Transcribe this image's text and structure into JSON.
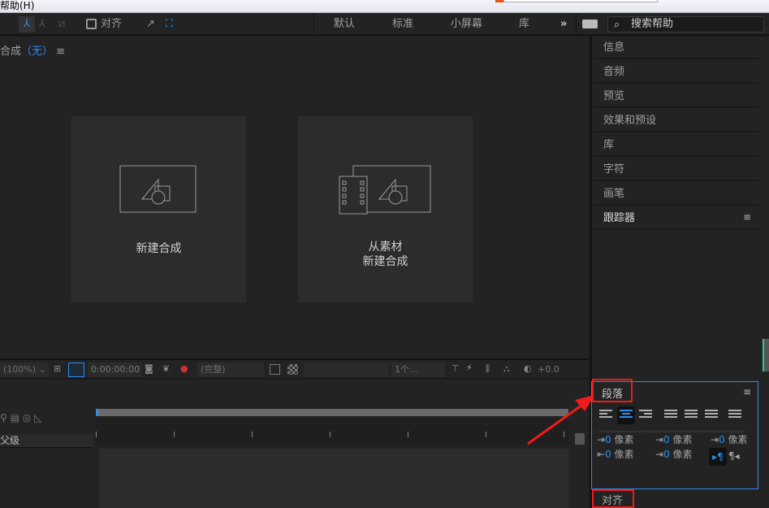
{
  "menubar": {
    "help": "帮助(H)"
  },
  "toolbar": {
    "snap_label": "对齐",
    "workspaces": [
      "默认",
      "标准",
      "小屏幕",
      "库"
    ],
    "more": "»",
    "search_placeholder": "搜索帮助"
  },
  "composition": {
    "title": "合成",
    "current": "（无）",
    "new_comp": "新建合成",
    "from_footage_line1": "从素材",
    "from_footage_line2": "新建合成"
  },
  "viewer_bar": {
    "zoom": "(100%)",
    "timecode": "0:00:00:00",
    "resolution": "(完整)",
    "views": "1个...",
    "exposure": "+0.0"
  },
  "timeline": {
    "column_label": "父级"
  },
  "right_panel": {
    "items": [
      "信息",
      "音频",
      "预览",
      "效果和预设",
      "库",
      "字符",
      "画笔",
      "跟踪器"
    ]
  },
  "paragraph": {
    "title": "段落",
    "unit": "像素",
    "indent_left": "0",
    "space_before": "0",
    "first_indent": "0",
    "indent_right": "0",
    "space_after": "0"
  },
  "align_panel": {
    "title": "对齐"
  },
  "colors": {
    "accent": "#2d8ceb",
    "annotation": "#f21b1b"
  }
}
